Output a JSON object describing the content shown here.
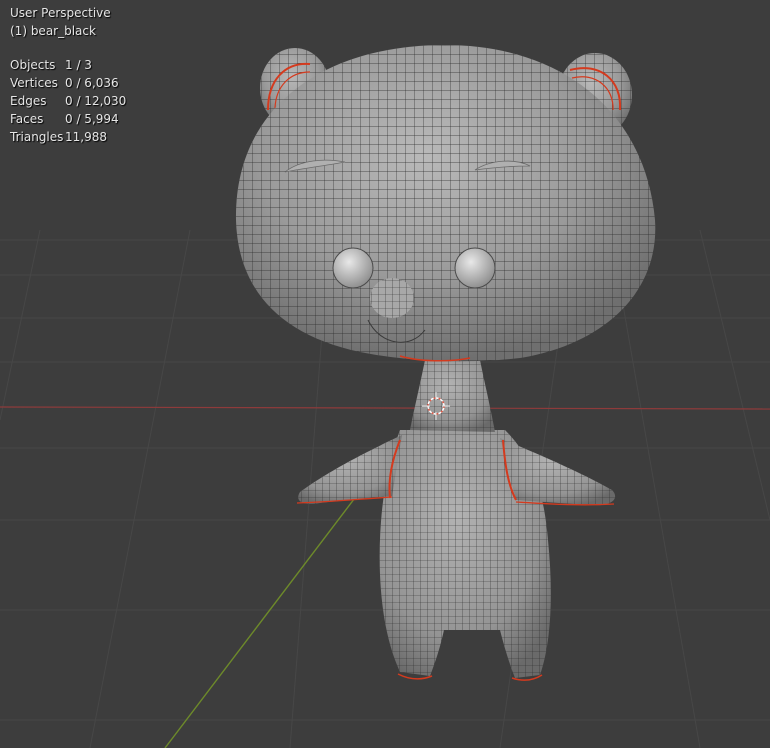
{
  "viewport": {
    "view_name": "User Perspective",
    "active_object": "(1) bear_black"
  },
  "stats": [
    {
      "label": "Objects",
      "value": "1 / 3"
    },
    {
      "label": "Vertices",
      "value": "0 / 6,036"
    },
    {
      "label": "Edges",
      "value": "0 / 12,030"
    },
    {
      "label": "Faces",
      "value": "0 / 5,994"
    },
    {
      "label": "Triangles",
      "value": "11,988"
    }
  ],
  "colors": {
    "background": "#3d3d3d",
    "grid": "#474747",
    "x_axis": "#8e3b3b",
    "y_axis": "#6d8a2a",
    "mesh": "#9b9b9b",
    "wire": "#2a2a2a",
    "seam": "#d43a1e"
  }
}
